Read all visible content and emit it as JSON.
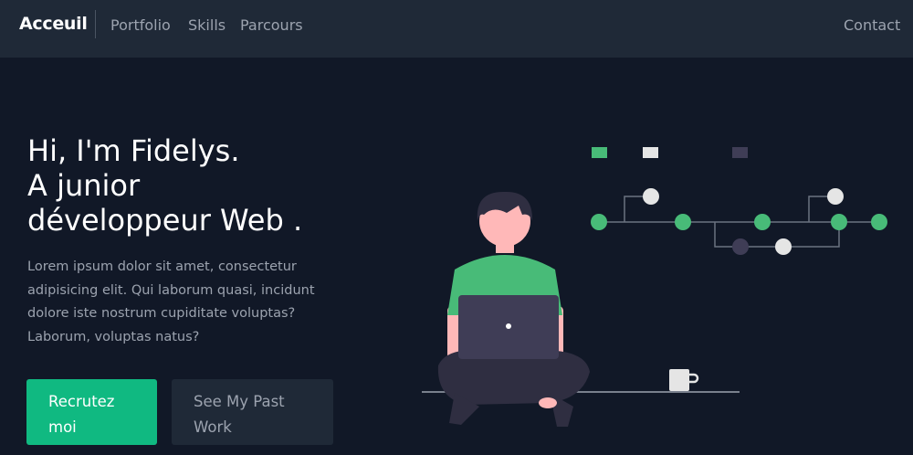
{
  "nav": {
    "brand": "Acceuil",
    "links": [
      "Portfolio",
      "Skills",
      "Parcours"
    ],
    "contact": "Contact"
  },
  "hero": {
    "title_lines": [
      "Hi, I'm Fidelys.",
      "A junior",
      "développeur Web ."
    ],
    "description": "Lorem ipsum dolor sit amet, consectetur adipisicing elit. Qui laborum quasi, incidunt dolore iste nostrum cupiditate voluptas? Laborum, voluptas natus?",
    "primary_button": "Recrutez moi",
    "secondary_button": "See My Past Work"
  },
  "colors": {
    "background": "#111827",
    "navbar": "#1f2937",
    "accent": "#10b981",
    "illustration_green": "#48bb78"
  },
  "illustration": {
    "name": "developer-with-laptop-illustration",
    "icons": [
      "person-icon",
      "laptop-icon",
      "coffee-mug-icon",
      "git-graph-icon"
    ]
  }
}
